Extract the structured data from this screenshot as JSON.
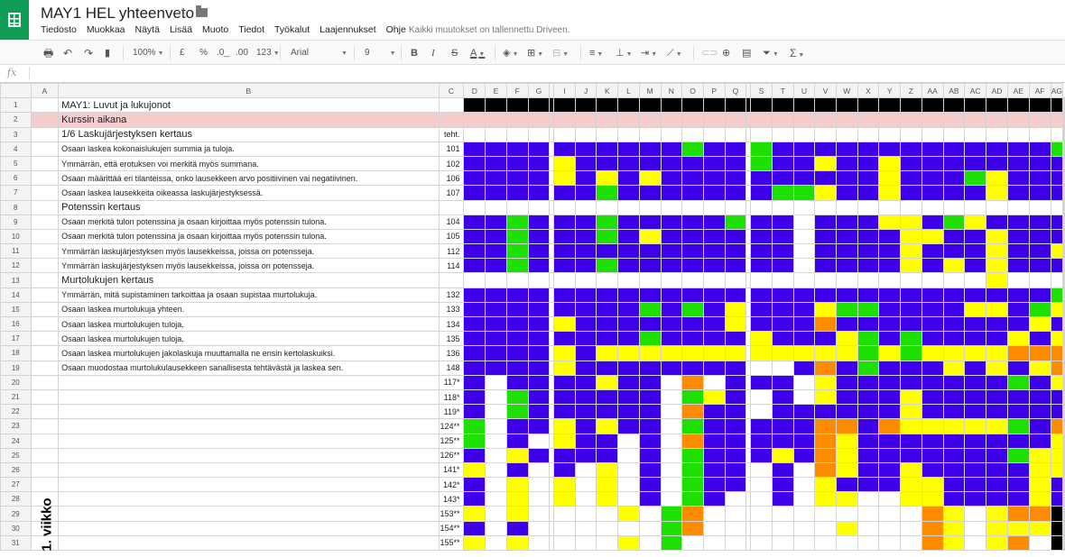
{
  "app": {
    "title": "MAY1 HEL yhteenveto",
    "menu": [
      "Tiedosto",
      "Muokkaa",
      "Näytä",
      "Lisää",
      "Muoto",
      "Tiedot",
      "Työkalut",
      "Laajennukset",
      "Ohje"
    ],
    "saved_message": "Kaikki muutokset on tallennettu Driveen."
  },
  "toolbar": {
    "zoom": "100%",
    "currency": "£",
    "percent": "%",
    "dec_less": ".0_",
    "dec_more": ".00",
    "format_more": "123",
    "font": "Arial",
    "font_size": "9",
    "bold": "B",
    "italic": "I",
    "strike": "S",
    "text_color": "A"
  },
  "formula_bar": {
    "fx": "fx"
  },
  "colors": {
    "B": "#3d00e8",
    "G": "#1ee000",
    "Y": "#ffff00",
    "O": "#ff8c00",
    "K": "#000000",
    "W": "#ffffff",
    "P": "#f4cccc"
  },
  "sheet": {
    "columns": [
      "A",
      "B",
      "C",
      "D",
      "E",
      "F",
      "G",
      "H",
      "I",
      "J",
      "K",
      "L",
      "M",
      "N",
      "O",
      "P",
      "Q",
      "R",
      "S",
      "T",
      "U",
      "V",
      "W",
      "X",
      "Y",
      "Z",
      "AA",
      "AB",
      "AC",
      "AD",
      "AE",
      "AF",
      "AG"
    ],
    "row_numbers": [
      "1",
      "2",
      "3",
      "4",
      "5",
      "6",
      "7",
      "8",
      "9",
      "10",
      "11",
      "12",
      "13",
      "14",
      "15",
      "16",
      "17",
      "18",
      "19",
      "20",
      "21",
      "22",
      "23",
      "24",
      "25",
      "26",
      "27",
      "28",
      "29",
      "30",
      "31"
    ],
    "week_label": "1. viikko",
    "rows": [
      {
        "b": "MAY1: Luvut ja lukujonot",
        "c": "",
        "style": "title"
      },
      {
        "b": "Kurssin aikana",
        "c": "",
        "style": "section-pink"
      },
      {
        "b": "1/6 Laskujärjestyksen kertaus",
        "c": "teht.",
        "style": "section"
      },
      {
        "b": "Osaan laskea kokonaislukujen summia ja tuloja.",
        "c": "101"
      },
      {
        "b": "Ymmärrän, että erotuksen voi merkitä myös summana.",
        "c": "102"
      },
      {
        "b": "Osaan määrittää eri tilanteissa, onko lausekkeen arvo positiivinen vai negatiivinen.",
        "c": "106"
      },
      {
        "b": "Osaan laskea lausekkeita oikeassa laskujärjestyksessä.",
        "c": "107"
      },
      {
        "b": "Potenssin kertaus",
        "c": "",
        "style": "section"
      },
      {
        "b": "Osaan merkitä tulon potenssina ja osaan kirjoittaa myös potenssin tulona.",
        "c": "104"
      },
      {
        "b": "Osaan merkitä tulon potenssina ja osaan kirjoittaa myös potenssin tulona.",
        "c": "105"
      },
      {
        "b": "Ymmärrän laskujärjestyksen myös lausekkeissa, joissa on potensseja.",
        "c": "112"
      },
      {
        "b": "Ymmärrän laskujärjestyksen myös lausekkeissa, joissa on potensseja.",
        "c": "114"
      },
      {
        "b": "Murtolukujen kertaus",
        "c": "",
        "style": "section"
      },
      {
        "b": "Ymmärrän, mitä supistaminen tarkoittaa ja osaan supistaa murtolukuja.",
        "c": "132"
      },
      {
        "b": "Osaan laskea murtolukuja yhteen.",
        "c": "133"
      },
      {
        "b": "Osaan laskea murtolukujen tuloja.",
        "c": "134"
      },
      {
        "b": "Osaan laskea murtolukujen tuloja.",
        "c": "135"
      },
      {
        "b": "Osaan laskea murtolukujen jakolaskuja muuttamalla ne ensin kertolaskuiksi.",
        "c": "136"
      },
      {
        "b": "Osaan muodostaa murtolukulausekkeen sanallisesta tehtävästä ja laskea sen.",
        "c": "148"
      },
      {
        "b": "",
        "c": "117*"
      },
      {
        "b": "",
        "c": "118*"
      },
      {
        "b": "",
        "c": "119*"
      },
      {
        "b": "",
        "c": "124**"
      },
      {
        "b": "",
        "c": "125**"
      },
      {
        "b": "",
        "c": "126**"
      },
      {
        "b": "",
        "c": "141*"
      },
      {
        "b": "",
        "c": "142*"
      },
      {
        "b": "",
        "c": "143*"
      },
      {
        "b": "",
        "c": "153**"
      },
      {
        "b": "",
        "c": "154**"
      },
      {
        "b": "",
        "c": "155**"
      }
    ],
    "cells": [
      "KKKKKKKKKKKKKKKKKKKKKKKKKKKKKK",
      "PPPPPPPPPPPPPPPPPPPPPPPPPPPPPP",
      "WWWWWWWWWWWWWWWWWWWWWWWWWWWWBW",
      "BBBBBBBBBBGBBGBBBBBBBBBBBBBGBG",
      "BBBBYBBBBBBBBGBBYBBYBBBBBBBBBB",
      "BBBBYBYBYBBBBBBBBBBYBBBGYBBBBB",
      "BBBBBBGBBBBBBBGGYBBYBBBBYBBBBB",
      "WWWWWWWWWWWWWWWWWWWWWWWWWWWWWW",
      "BBGBBBGBBBBBGBBWBBBYYBGYBBBBBB",
      "BBGBBBGBYBBBBBBWBBBBYYBBYBBBBB",
      "BBGBBBBBBBBBBBBWBBBBYBBBYBBYBB",
      "BBGBBBGBBBBBBBBWBBBBYBYBYBBBGB",
      "WWWWWWWWWWWWWWWWWWWWWWWWYWWWWW",
      "BBBBBBBBBBBBBBBBBBBBBBBBBBBGBB",
      "BBBBBBBBGBGBYBBBYGGBBBBYYBGYOB",
      "BBBBYBBBBBBBYBBBOBBBBBBBBBYBBB",
      "BBBBBBBBGBBBBYBBBYGBGBBBBYBYBB",
      "BBBBYBYYYYYYYYYYYYGYGYYYYOOOBB",
      "BBBBYBBBBBBBBWWBOBGBBBYBYBYOYB",
      "BWBBBBYBBWOWBBBWYBBBBBBBBGBYBY",
      "BWGBBBBBBWGYBWBWYBBBYBBBBBBBBB",
      "BWGBBBBBBWOBBWBBBBBBYBBBBBBBBB",
      "GWBBYBYBBWGBBBBBOOBOYYYYYGBOYB",
      "GWBWYBBWBWOBBBBBOYBBBBBBBBBYOB",
      "BWYBBBBWBWGBBBYBOYBBBBBBBGYYBB",
      "YWBWBWYWBWGBBWBWOYBBYBBBBBYYBB",
      "BWYWYWYWBWGBBWBWYBBBYYBBBBYBBB",
      "BWYWYWYWBWGBWWBWYYWWYYBBBBYBBB",
      "YWYWWWWYWGOWWWWWWWWWWOYWYOOKKW",
      "BWBWWWWWWGOWWWWWWYWWWOYWYYYKOW",
      "YWYWWWWYWGWWWWWWWWWWWOYWYOWKKW"
    ]
  }
}
